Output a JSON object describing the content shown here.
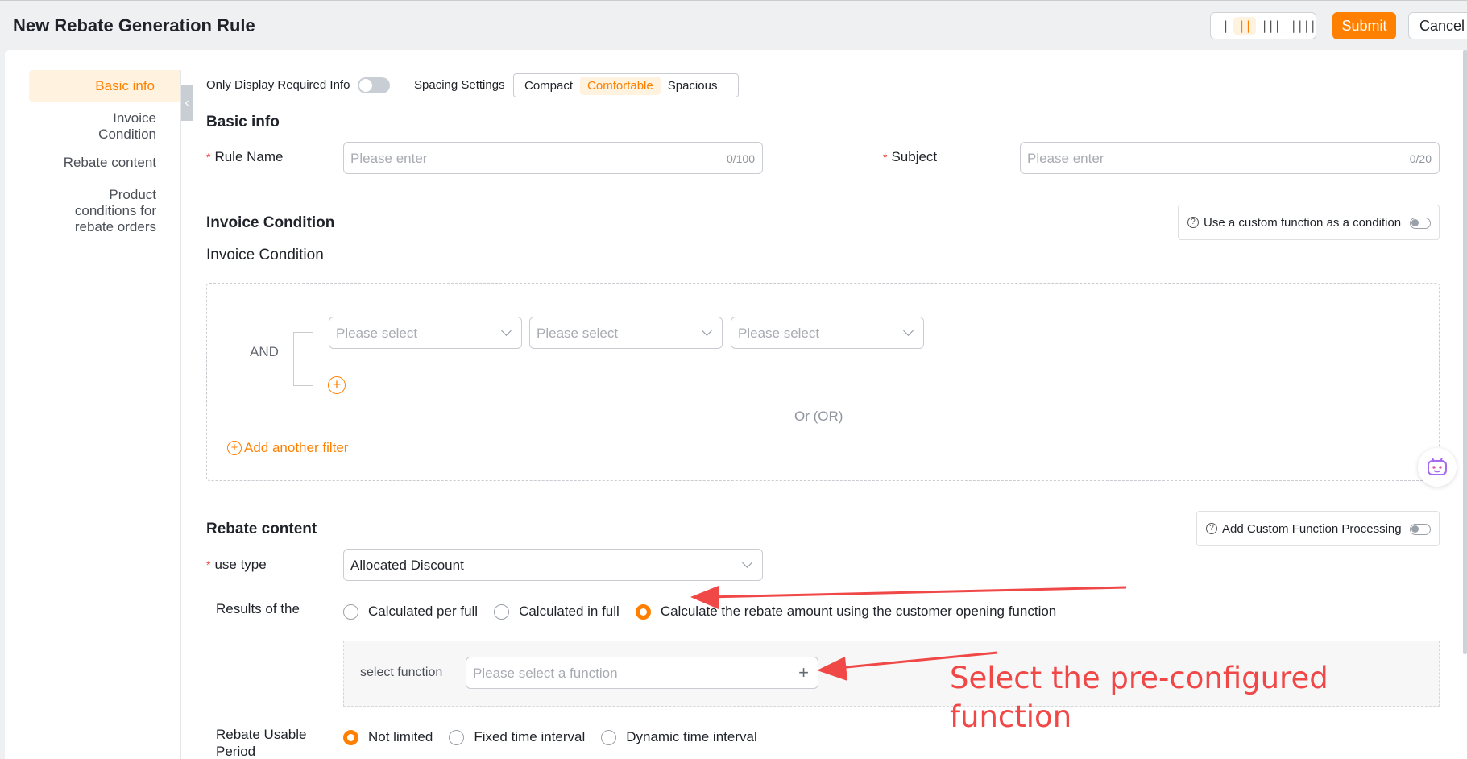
{
  "header": {
    "title": "New Rebate Generation Rule",
    "column_options": [
      "|",
      "||",
      "|||",
      "||||"
    ],
    "submit_label": "Submit",
    "cancel_label": "Cancel"
  },
  "sidebar": {
    "items": [
      {
        "label": "Basic info"
      },
      {
        "label": "Invoice\nCondition"
      },
      {
        "label": "Rebate content"
      },
      {
        "label": "Product\nconditions for\nrebate orders"
      }
    ]
  },
  "settings": {
    "only_required_label": "Only Display Required Info",
    "spacing_label": "Spacing Settings",
    "spacing_options": [
      "Compact",
      "Comfortable",
      "Spacious"
    ]
  },
  "basic_info": {
    "title": "Basic info",
    "rule_name": {
      "label": "Rule Name",
      "placeholder": "Please enter",
      "counter": "0/100"
    },
    "subject": {
      "label": "Subject",
      "placeholder": "Please enter",
      "counter": "0/20"
    }
  },
  "invoice_condition": {
    "title": "Invoice Condition",
    "subtitle": "Invoice Condition",
    "custom_function_label": "Use a custom function as a condition",
    "and_label": "AND",
    "selects": [
      "Please select",
      "Please select",
      "Please select"
    ],
    "or_label": "Or (OR)",
    "add_filter_label": "Add another filter"
  },
  "rebate_content": {
    "title": "Rebate content",
    "custom_function_label": "Add Custom Function Processing",
    "use_type": {
      "label": "use type",
      "value": "Allocated Discount"
    },
    "results": {
      "label": "Results of the",
      "options": [
        "Calculated per full",
        "Calculated in full",
        "Calculate the rebate amount using the customer opening function"
      ]
    },
    "select_function": {
      "label": "select function",
      "placeholder": "Please select a function"
    },
    "usable_period": {
      "label": "Rebate Usable\nPeriod",
      "options": [
        "Not limited",
        "Fixed time interval",
        "Dynamic time interval"
      ]
    }
  },
  "annotation": {
    "text": "Select the pre-configured\nfunction"
  },
  "colors": {
    "accent": "#ff8000",
    "required": "#f54a45",
    "annotation": "#f04747"
  }
}
